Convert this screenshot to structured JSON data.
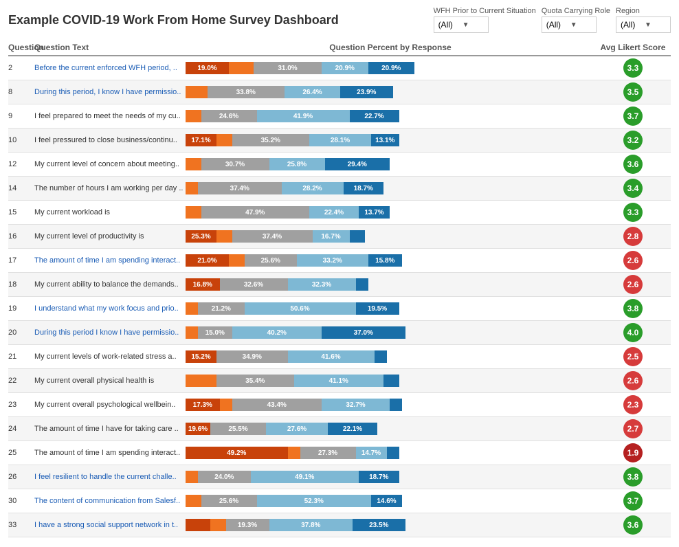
{
  "title": "Example COVID-19 Work From Home Survey Dashboard",
  "filters": [
    {
      "label": "WFH Prior to Current Situation",
      "value": "(All)",
      "name": "wfh-filter"
    },
    {
      "label": "Quota Carrying Role",
      "value": "(All)",
      "name": "quota-filter"
    },
    {
      "label": "Region",
      "value": "(All)",
      "name": "region-filter"
    }
  ],
  "table_headers": {
    "question": "Question",
    "question_text": "Question Text",
    "chart": "Question Percent by Response",
    "score": "Avg Likert Score"
  },
  "rows": [
    {
      "id": 2,
      "text": "Before the current enforced WFH period, ..",
      "text_color": "blue",
      "bars": [
        {
          "color": "dark-orange",
          "pct": 14,
          "label": "19.0%"
        },
        {
          "color": "orange",
          "pct": 8,
          "label": ""
        },
        {
          "color": "gray",
          "pct": 22,
          "label": "31.0%"
        },
        {
          "color": "light-blue",
          "pct": 15,
          "label": "20.9%"
        },
        {
          "color": "dark-blue",
          "pct": 15,
          "label": "20.9%"
        }
      ],
      "score": "3.3",
      "score_color": "green"
    },
    {
      "id": 8,
      "text": "During this period, I know I have permissio..",
      "text_color": "blue",
      "bars": [
        {
          "color": "dark-orange",
          "pct": 0,
          "label": ""
        },
        {
          "color": "orange",
          "pct": 7,
          "label": ""
        },
        {
          "color": "gray",
          "pct": 25,
          "label": "33.8%"
        },
        {
          "color": "light-blue",
          "pct": 18,
          "label": "26.4%"
        },
        {
          "color": "dark-blue",
          "pct": 17,
          "label": "23.9%"
        }
      ],
      "score": "3.5",
      "score_color": "green"
    },
    {
      "id": 9,
      "text": "I feel prepared to meet the needs of my cu..",
      "text_color": "black",
      "bars": [
        {
          "color": "dark-orange",
          "pct": 0,
          "label": ""
        },
        {
          "color": "orange",
          "pct": 5,
          "label": ""
        },
        {
          "color": "gray",
          "pct": 18,
          "label": "24.6%"
        },
        {
          "color": "light-blue",
          "pct": 30,
          "label": "41.9%"
        },
        {
          "color": "dark-blue",
          "pct": 16,
          "label": "22.7%"
        }
      ],
      "score": "3.7",
      "score_color": "green"
    },
    {
      "id": 10,
      "text": "I feel pressured to close business/continu..",
      "text_color": "black",
      "bars": [
        {
          "color": "dark-orange",
          "pct": 10,
          "label": "17.1%"
        },
        {
          "color": "orange",
          "pct": 5,
          "label": ""
        },
        {
          "color": "gray",
          "pct": 25,
          "label": "35.2%"
        },
        {
          "color": "light-blue",
          "pct": 20,
          "label": "28.1%"
        },
        {
          "color": "dark-blue",
          "pct": 9,
          "label": "13.1%"
        }
      ],
      "score": "3.2",
      "score_color": "green"
    },
    {
      "id": 12,
      "text": "My current level of concern about meeting..",
      "text_color": "black",
      "bars": [
        {
          "color": "dark-orange",
          "pct": 0,
          "label": ""
        },
        {
          "color": "orange",
          "pct": 5,
          "label": ""
        },
        {
          "color": "gray",
          "pct": 22,
          "label": "30.7%"
        },
        {
          "color": "light-blue",
          "pct": 18,
          "label": "25.8%"
        },
        {
          "color": "dark-blue",
          "pct": 21,
          "label": "29.4%"
        }
      ],
      "score": "3.6",
      "score_color": "green"
    },
    {
      "id": 14,
      "text": "The number of hours I am working per day ..",
      "text_color": "black",
      "bars": [
        {
          "color": "dark-orange",
          "pct": 0,
          "label": ""
        },
        {
          "color": "orange",
          "pct": 4,
          "label": ""
        },
        {
          "color": "gray",
          "pct": 27,
          "label": "37.4%"
        },
        {
          "color": "light-blue",
          "pct": 20,
          "label": "28.2%"
        },
        {
          "color": "dark-blue",
          "pct": 13,
          "label": "18.7%"
        }
      ],
      "score": "3.4",
      "score_color": "green"
    },
    {
      "id": 15,
      "text": "My current workload is",
      "text_color": "black",
      "bars": [
        {
          "color": "dark-orange",
          "pct": 0,
          "label": ""
        },
        {
          "color": "orange",
          "pct": 5,
          "label": ""
        },
        {
          "color": "gray",
          "pct": 35,
          "label": "47.9%"
        },
        {
          "color": "light-blue",
          "pct": 16,
          "label": "22.4%"
        },
        {
          "color": "dark-blue",
          "pct": 10,
          "label": "13.7%"
        }
      ],
      "score": "3.3",
      "score_color": "green"
    },
    {
      "id": 16,
      "text": "My current level of productivity is",
      "text_color": "black",
      "bars": [
        {
          "color": "dark-orange",
          "pct": 10,
          "label": "25.3%"
        },
        {
          "color": "orange",
          "pct": 5,
          "label": ""
        },
        {
          "color": "gray",
          "pct": 26,
          "label": "37.4%"
        },
        {
          "color": "light-blue",
          "pct": 12,
          "label": "16.7%"
        },
        {
          "color": "dark-blue",
          "pct": 5,
          "label": ""
        }
      ],
      "score": "2.8",
      "score_color": "red"
    },
    {
      "id": 17,
      "text": "The amount of time I am spending interact..",
      "text_color": "blue",
      "bars": [
        {
          "color": "dark-orange",
          "pct": 14,
          "label": "21.0%"
        },
        {
          "color": "orange",
          "pct": 5,
          "label": ""
        },
        {
          "color": "gray",
          "pct": 17,
          "label": "25.6%"
        },
        {
          "color": "light-blue",
          "pct": 23,
          "label": "33.2%"
        },
        {
          "color": "dark-blue",
          "pct": 11,
          "label": "15.8%"
        }
      ],
      "score": "2.6",
      "score_color": "red"
    },
    {
      "id": 18,
      "text": "My current ability to balance the demands..",
      "text_color": "black",
      "bars": [
        {
          "color": "dark-orange",
          "pct": 11,
          "label": "16.8%"
        },
        {
          "color": "orange",
          "pct": 0,
          "label": ""
        },
        {
          "color": "gray",
          "pct": 22,
          "label": "32.6%"
        },
        {
          "color": "light-blue",
          "pct": 22,
          "label": "32.3%"
        },
        {
          "color": "dark-blue",
          "pct": 4,
          "label": ""
        }
      ],
      "score": "2.6",
      "score_color": "red"
    },
    {
      "id": 19,
      "text": "I understand what my work focus and prio..",
      "text_color": "blue",
      "bars": [
        {
          "color": "dark-orange",
          "pct": 0,
          "label": ""
        },
        {
          "color": "orange",
          "pct": 4,
          "label": ""
        },
        {
          "color": "gray",
          "pct": 15,
          "label": "21.2%"
        },
        {
          "color": "light-blue",
          "pct": 36,
          "label": "50.6%"
        },
        {
          "color": "dark-blue",
          "pct": 14,
          "label": "19.5%"
        }
      ],
      "score": "3.8",
      "score_color": "green"
    },
    {
      "id": 20,
      "text": "During this period I know I have permissio..",
      "text_color": "blue",
      "bars": [
        {
          "color": "dark-orange",
          "pct": 0,
          "label": ""
        },
        {
          "color": "orange",
          "pct": 4,
          "label": ""
        },
        {
          "color": "gray",
          "pct": 11,
          "label": "15.0%"
        },
        {
          "color": "light-blue",
          "pct": 29,
          "label": "40.2%"
        },
        {
          "color": "dark-blue",
          "pct": 27,
          "label": "37.0%"
        }
      ],
      "score": "4.0",
      "score_color": "green"
    },
    {
      "id": 21,
      "text": "My current levels of work-related stress a..",
      "text_color": "black",
      "bars": [
        {
          "color": "dark-orange",
          "pct": 10,
          "label": "15.2%"
        },
        {
          "color": "orange",
          "pct": 0,
          "label": ""
        },
        {
          "color": "gray",
          "pct": 23,
          "label": "34.9%"
        },
        {
          "color": "light-blue",
          "pct": 28,
          "label": "41.6%"
        },
        {
          "color": "dark-blue",
          "pct": 4,
          "label": ""
        }
      ],
      "score": "2.5",
      "score_color": "red"
    },
    {
      "id": 22,
      "text": "My current overall physical health is",
      "text_color": "black",
      "bars": [
        {
          "color": "dark-orange",
          "pct": 0,
          "label": ""
        },
        {
          "color": "orange",
          "pct": 10,
          "label": ""
        },
        {
          "color": "gray",
          "pct": 25,
          "label": "35.4%"
        },
        {
          "color": "light-blue",
          "pct": 29,
          "label": "41.1%"
        },
        {
          "color": "dark-blue",
          "pct": 5,
          "label": ""
        }
      ],
      "score": "2.6",
      "score_color": "red"
    },
    {
      "id": 23,
      "text": "My current overall psychological wellbein..",
      "text_color": "black",
      "bars": [
        {
          "color": "dark-orange",
          "pct": 11,
          "label": "17.3%"
        },
        {
          "color": "orange",
          "pct": 4,
          "label": ""
        },
        {
          "color": "gray",
          "pct": 29,
          "label": "43.4%"
        },
        {
          "color": "light-blue",
          "pct": 22,
          "label": "32.7%"
        },
        {
          "color": "dark-blue",
          "pct": 4,
          "label": ""
        }
      ],
      "score": "2.3",
      "score_color": "red"
    },
    {
      "id": 24,
      "text": "The amount of time I have for taking care ..",
      "text_color": "black",
      "bars": [
        {
          "color": "dark-orange",
          "pct": 8,
          "label": "19.6%"
        },
        {
          "color": "orange",
          "pct": 0,
          "label": ""
        },
        {
          "color": "gray",
          "pct": 18,
          "label": "25.5%"
        },
        {
          "color": "light-blue",
          "pct": 20,
          "label": "27.6%"
        },
        {
          "color": "dark-blue",
          "pct": 16,
          "label": "22.1%"
        }
      ],
      "score": "2.7",
      "score_color": "red"
    },
    {
      "id": 25,
      "text": "The amount of time I am spending interact..",
      "text_color": "black",
      "bars": [
        {
          "color": "dark-orange",
          "pct": 33,
          "label": "49.2%"
        },
        {
          "color": "orange",
          "pct": 4,
          "label": ""
        },
        {
          "color": "gray",
          "pct": 18,
          "label": "27.3%"
        },
        {
          "color": "light-blue",
          "pct": 10,
          "label": "14.7%"
        },
        {
          "color": "dark-blue",
          "pct": 4,
          "label": ""
        }
      ],
      "score": "1.9",
      "score_color": "darkred"
    },
    {
      "id": 26,
      "text": "I feel resilient to handle the current challe..",
      "text_color": "blue",
      "bars": [
        {
          "color": "dark-orange",
          "pct": 0,
          "label": ""
        },
        {
          "color": "orange",
          "pct": 4,
          "label": ""
        },
        {
          "color": "gray",
          "pct": 17,
          "label": "24.0%"
        },
        {
          "color": "light-blue",
          "pct": 35,
          "label": "49.1%"
        },
        {
          "color": "dark-blue",
          "pct": 13,
          "label": "18.7%"
        }
      ],
      "score": "3.8",
      "score_color": "green"
    },
    {
      "id": 30,
      "text": "The content of communication from Salesf..",
      "text_color": "blue",
      "bars": [
        {
          "color": "dark-orange",
          "pct": 0,
          "label": ""
        },
        {
          "color": "orange",
          "pct": 5,
          "label": ""
        },
        {
          "color": "gray",
          "pct": 18,
          "label": "25.6%"
        },
        {
          "color": "light-blue",
          "pct": 37,
          "label": "52.3%"
        },
        {
          "color": "dark-blue",
          "pct": 10,
          "label": "14.6%"
        }
      ],
      "score": "3.7",
      "score_color": "green"
    },
    {
      "id": 33,
      "text": "I have a strong social support network in t..",
      "text_color": "blue",
      "bars": [
        {
          "color": "dark-orange",
          "pct": 8,
          "label": ""
        },
        {
          "color": "orange",
          "pct": 5,
          "label": ""
        },
        {
          "color": "gray",
          "pct": 14,
          "label": "19.3%"
        },
        {
          "color": "light-blue",
          "pct": 27,
          "label": "37.8%"
        },
        {
          "color": "dark-blue",
          "pct": 17,
          "label": "23.5%"
        }
      ],
      "score": "3.6",
      "score_color": "green"
    }
  ]
}
